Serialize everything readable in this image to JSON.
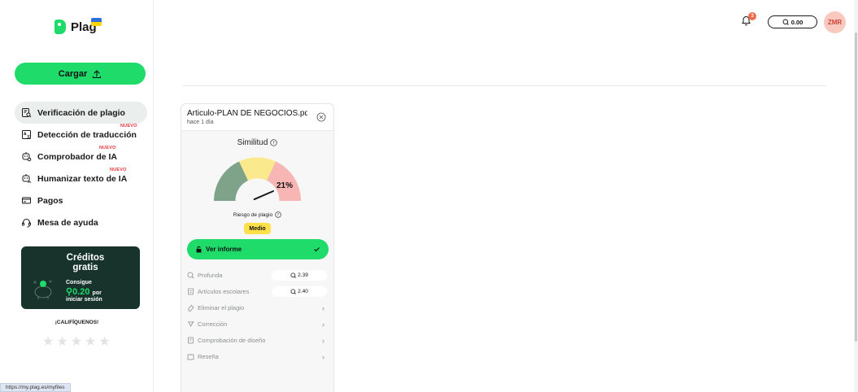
{
  "brand": {
    "name": "Plag"
  },
  "sidebar": {
    "upload_label": "Cargar",
    "items": [
      {
        "label": "Verificación de plagio",
        "badge": ""
      },
      {
        "label": "Detección de traducción",
        "badge": "NUEVO"
      },
      {
        "label": "Comprobador de IA",
        "badge": "NUEVO"
      },
      {
        "label": "Humanizar texto de IA",
        "badge": "NUEVO"
      },
      {
        "label": "Pagos",
        "badge": ""
      },
      {
        "label": "Mesa de ayuda",
        "badge": ""
      }
    ],
    "credits": {
      "title_1": "Créditos",
      "title_2": "gratis",
      "line1": "Consigue",
      "amount": "0.20",
      "line2_suffix": "por",
      "line3": "iniciar sesión"
    },
    "rate_label": "¡CALIFÍQUENOS!",
    "stars": [
      "★",
      "★",
      "★",
      "★",
      "★"
    ]
  },
  "header": {
    "notifications": "3",
    "balance": "0.00",
    "avatar": "ZMR"
  },
  "card": {
    "title": "Articulo-PLAN DE NEGOCIOS.pdf",
    "time": "hace 1 día",
    "similarity_label": "Similitud",
    "similarity_value": "21%",
    "similarity_fraction": 0.21,
    "risk_label": "Riesgo de plagio",
    "risk_value": "Medio",
    "report_label": "Ver informe",
    "options": [
      {
        "label": "Profunda",
        "price": "2.39"
      },
      {
        "label": "Artículos escolares",
        "price": "2.40"
      },
      {
        "label": "Eliminar el plagio"
      },
      {
        "label": "Corrección"
      },
      {
        "label": "Comprobación de diseño"
      },
      {
        "label": "Reseña"
      }
    ]
  },
  "status_url": "https://my.plag.es/myfiles",
  "colors": {
    "accent": "#1fdb6a",
    "gauge_low": "#7fa388",
    "gauge_mid": "#fbe98e",
    "gauge_high": "#f7b6b4",
    "credits_bg": "#17332c",
    "risk_badge": "#ffe04a"
  }
}
